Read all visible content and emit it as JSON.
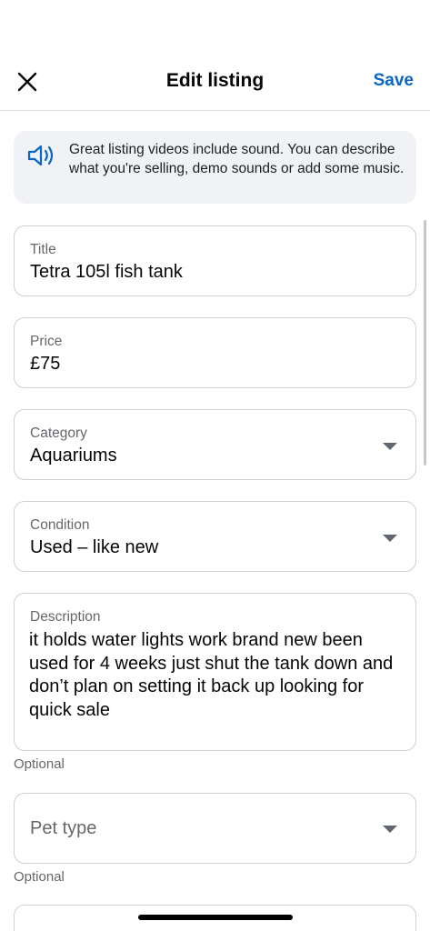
{
  "header": {
    "title": "Edit listing",
    "save_label": "Save",
    "close_icon": "close-icon"
  },
  "info_banner": {
    "icon": "speaker-icon",
    "text": "Great listing videos include sound. You can describe what you're selling, demo sounds or add some music."
  },
  "fields": {
    "title": {
      "label": "Title",
      "value": "Tetra 105l fish tank"
    },
    "price": {
      "label": "Price",
      "value": "£75"
    },
    "category": {
      "label": "Category",
      "value": "Aquariums"
    },
    "condition": {
      "label": "Condition",
      "value": "Used – like new"
    },
    "description": {
      "label": "Description",
      "value": "it holds water lights work brand new been used for 4 weeks just shut the tank down and don’t plan on setting it back up looking for quick sale",
      "helper": "Optional"
    },
    "pet_type": {
      "placeholder": "Pet type",
      "helper": "Optional"
    }
  },
  "colors": {
    "accent": "#0866c6",
    "banner_bg": "#f0f2f5",
    "border": "#ced0d4",
    "secondary_text": "#65676b"
  }
}
